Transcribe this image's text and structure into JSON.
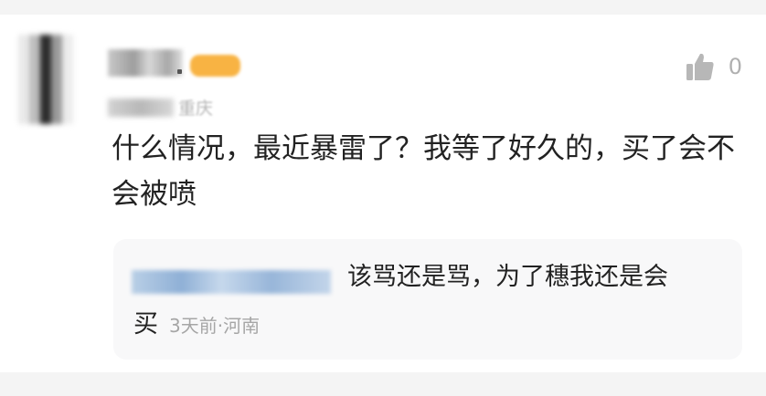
{
  "comment": {
    "location": "重庆",
    "like_count": "0",
    "text": "什么情况，最近暴雷了？我等了好久的，买了会不会被喷"
  },
  "reply": {
    "text_line1": "该骂还是骂，为了穗我还是会",
    "text_line2": "买",
    "meta": "3天前·河南"
  },
  "icons": {
    "like": "thumbs-up-icon"
  }
}
